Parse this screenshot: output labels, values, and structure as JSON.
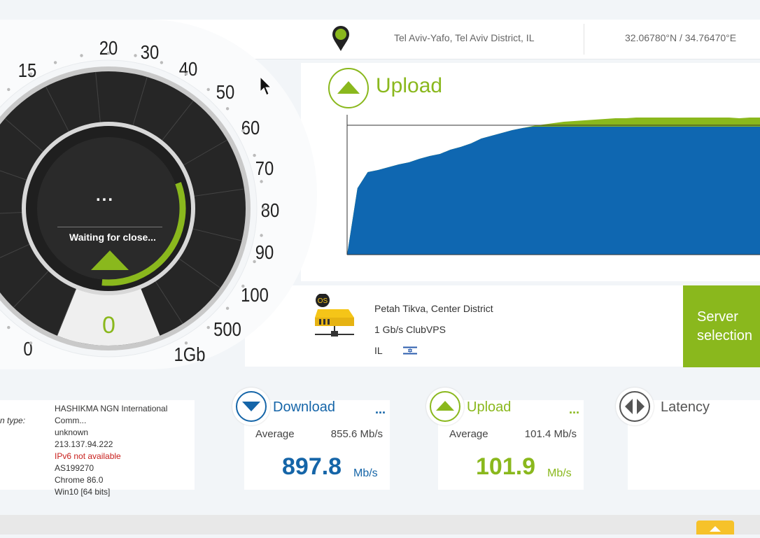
{
  "location": {
    "city": "Tel Aviv-Yafo, Tel Aviv District, IL",
    "coords": "32.06780°N / 34.76470°E"
  },
  "gauge": {
    "labels": [
      "0",
      "15",
      "20",
      "30",
      "40",
      "50",
      "60",
      "70",
      "80",
      "90",
      "100",
      "500",
      "1Gb"
    ],
    "status": "Waiting for close...",
    "dots": "...",
    "value": "0",
    "colors": {
      "accent": "#8ab81d",
      "dial": "#262626"
    }
  },
  "upload_chart": {
    "title": "Upload"
  },
  "chart_data": {
    "type": "area",
    "series": [
      {
        "name": "",
        "color": "#8ab81d",
        "values": [
          0,
          95,
          118,
          121,
          125,
          129,
          132,
          137,
          141,
          144,
          150,
          154,
          159,
          166,
          170,
          174,
          178,
          181,
          184,
          186,
          188,
          190,
          191,
          192,
          193,
          194,
          195,
          195,
          196,
          196,
          196,
          196,
          196,
          196,
          196,
          196,
          196,
          196,
          195,
          196,
          196
        ]
      },
      {
        "name": "",
        "color": "#0f67b1",
        "values": [
          0,
          95,
          118,
          121,
          125,
          129,
          132,
          137,
          141,
          144,
          150,
          154,
          159,
          166,
          170,
          174,
          178,
          181,
          183,
          183,
          183,
          183,
          183,
          183,
          183,
          183,
          183,
          183,
          183,
          183,
          183,
          183,
          183,
          183,
          183,
          183,
          183,
          183,
          183,
          183,
          183
        ]
      }
    ],
    "grid": false
  },
  "server": {
    "name": "Petah Tikva, Center District",
    "provider": "1 Gb/s ClubVPS",
    "country": "IL",
    "os_badge": "OS",
    "button": "Server selection",
    "colors": {
      "button": "#8ab81d",
      "drive": "#f5c518"
    }
  },
  "connection": {
    "label": "n type:",
    "isp": "HASHIKMA NGN International Comm...",
    "type": "unknown",
    "ip": "213.137.94.222",
    "ipv6": "IPv6 not available",
    "as": "AS199270",
    "browser": "Chrome 86.0",
    "os": "Win10 [64 bits]"
  },
  "download": {
    "title": "Download",
    "more": "...",
    "avg_label": "Average",
    "avg": "855.6 Mb/s",
    "value": "897.8",
    "unit": "Mb/s",
    "color": "#1565a8"
  },
  "upload": {
    "title": "Upload",
    "more": "...",
    "avg_label": "Average",
    "avg": "101.4 Mb/s",
    "value": "101.9",
    "unit": "Mb/s",
    "color": "#8ab81d"
  },
  "latency": {
    "title": "Latency"
  }
}
